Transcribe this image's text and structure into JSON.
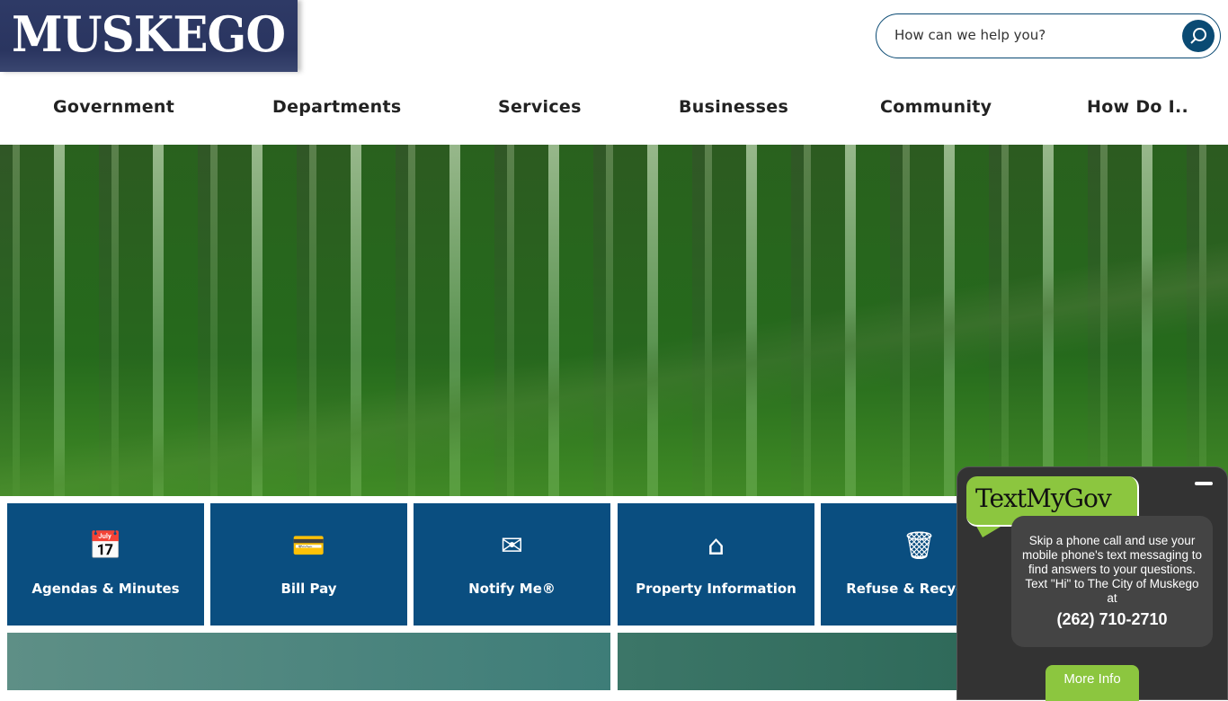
{
  "header": {
    "logo_text": "MUSKEGO",
    "search_placeholder": "How can we help you?"
  },
  "nav": [
    "Government",
    "Departments",
    "Services",
    "Businesses",
    "Community",
    "How Do I.."
  ],
  "tiles": [
    {
      "label": "Agendas & Minutes",
      "icon": "calendar-clock-icon",
      "glyph": "📅"
    },
    {
      "label": "Bill Pay",
      "icon": "credit-card-icon",
      "glyph": "💳"
    },
    {
      "label": "Notify Me®",
      "icon": "envelope-icon",
      "glyph": "✉"
    },
    {
      "label": "Property Information",
      "icon": "house-icon",
      "glyph": "⌂"
    },
    {
      "label": "Refuse & Recycling",
      "icon": "trash-icon",
      "glyph": "🗑"
    }
  ],
  "textmygov": {
    "title": "TextMyGov",
    "message": "Skip a phone call and use your mobile phone's text messaging to find answers to your questions. Text \"Hi\" to The City of Muskego at",
    "phone": "(262) 710-2710",
    "button": "More Info"
  },
  "colors": {
    "navy": "#2a3560",
    "tile_blue": "#0a4e80",
    "green": "#8cc63f"
  }
}
